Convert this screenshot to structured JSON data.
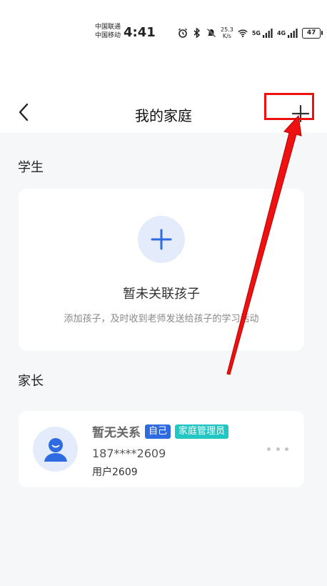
{
  "status_bar": {
    "carrier_1": "中国联通",
    "carrier_2": "中国移动",
    "time": "4:41",
    "speed_value": "25.3",
    "speed_unit": "K/s",
    "network_1": "5G",
    "network_2": "4G",
    "battery": "47"
  },
  "nav": {
    "title": "我的家庭",
    "back_icon": "chevron-left-icon",
    "add_icon": "plus-icon"
  },
  "students": {
    "section_title": "学生",
    "empty_title": "暂未关联孩子",
    "empty_desc": "添加孩子，及时收到老师发送给孩子的学习活动"
  },
  "parents": {
    "section_title": "家长",
    "items": [
      {
        "name": "暂无关系",
        "badge_self": "自己",
        "badge_admin": "家庭管理员",
        "phone": "187****2609",
        "user": "用户2609"
      }
    ]
  },
  "colors": {
    "accent": "#2f6be0",
    "admin_badge": "#22c6c2",
    "annotation": "#e11111",
    "page_bg": "#f6f7f9"
  }
}
